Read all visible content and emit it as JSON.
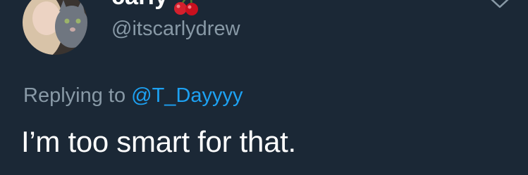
{
  "tweet": {
    "author": {
      "display_name": "carly",
      "handle": "@itscarlydrew",
      "emoji_icon": "cherries-icon"
    },
    "reply_context": {
      "prefix": "Replying to ",
      "mention": "@T_Dayyyy"
    },
    "text": "I’m too smart for that.",
    "menu_icon": "chevron-down-icon"
  },
  "colors": {
    "background": "#1b2836",
    "primary_text": "#ffffff",
    "secondary_text": "#8899a6",
    "link": "#1da1f2"
  }
}
